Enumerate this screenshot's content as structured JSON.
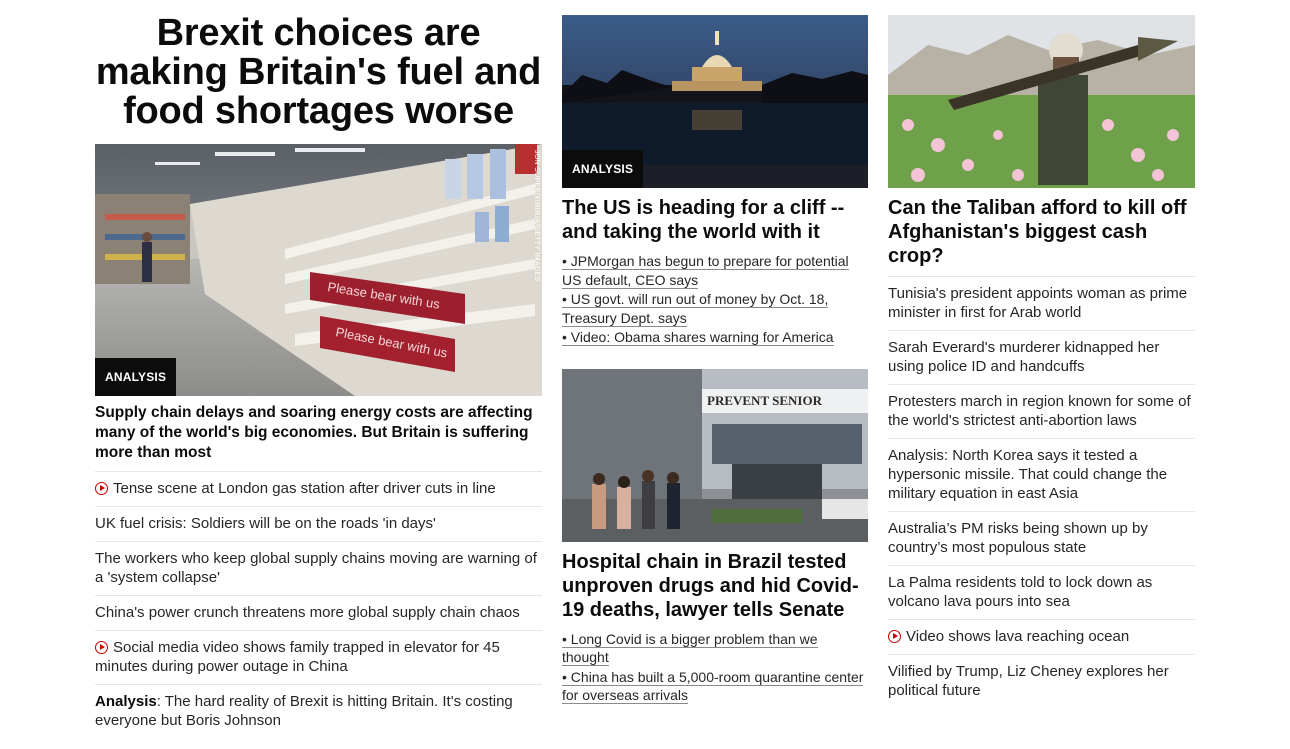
{
  "col1": {
    "headline": "Brexit choices are making Britain's fuel and food shortages worse",
    "image_credit": "JON SUPER/XINHUA/GETTY IMAGES",
    "image_badge": "ANALYSIS",
    "shelf_sign_1": "Please bear with us",
    "shelf_sign_2": "Please bear with us",
    "summary": "Supply chain delays and soaring energy costs are affecting many of the world's big economies. But Britain is suffering more than most",
    "items": [
      {
        "text": "Tense scene at London gas station after driver cuts in line",
        "video": true
      },
      {
        "text": "UK fuel crisis: Soldiers will be on the roads 'in days'",
        "video": false
      },
      {
        "text": "The workers who keep global supply chains moving are warning of a 'system collapse'",
        "video": false
      },
      {
        "text": "China's power crunch threatens more global supply chain chaos",
        "video": false
      },
      {
        "text": "Social media video shows family trapped in elevator for 45 minutes during power outage in China",
        "video": true
      }
    ],
    "last_item": {
      "lead": "Analysis",
      "text": ": The hard reality of Brexit is hitting Britain. It's costing everyone but Boris Johnson"
    }
  },
  "col2": {
    "story1": {
      "badge": "ANALYSIS",
      "headline": "The US is heading for a cliff -- and taking the world with it",
      "bullets": [
        "• JPMorgan has begun to prepare for potential US default, CEO says",
        "• US govt. will run out of money by Oct. 18, Treasury Dept. says",
        "• Video: Obama shares warning for America"
      ]
    },
    "story2": {
      "sign": "PREVENT SENIOR",
      "headline": "Hospital chain in Brazil tested unproven drugs and hid Covid-19 deaths, lawyer tells Senate",
      "bullets": [
        "• Long Covid is a bigger problem than we thought",
        "• China has built a 5,000-room quarantine center for overseas arrivals"
      ]
    }
  },
  "col3": {
    "headline": "Can the Taliban afford to kill off Afghanistan's biggest cash crop?",
    "items": [
      {
        "text": "Tunisia's president appoints woman as prime minister in first for Arab world",
        "video": false
      },
      {
        "text": "Sarah Everard's murderer kidnapped her using police ID and handcuffs",
        "video": false
      },
      {
        "text": "Protesters march in region known for some of the world's strictest anti-abortion laws",
        "video": false
      },
      {
        "text": "Analysis: North Korea says it tested a hypersonic missile. That could change the military equation in east Asia",
        "video": false
      },
      {
        "text": "Australia’s PM risks being shown up by country’s most populous state",
        "video": false
      },
      {
        "text": "La Palma residents told to lock down as volcano lava pours into sea",
        "video": false
      },
      {
        "text": "Video shows lava reaching ocean",
        "video": true
      },
      {
        "text": "Vilified by Trump, Liz Cheney explores her political future",
        "video": false
      }
    ]
  },
  "colors": {
    "video_red": "#cc0000",
    "badge_bg": "#0c0c0c",
    "divider": "#e6e6e6"
  }
}
